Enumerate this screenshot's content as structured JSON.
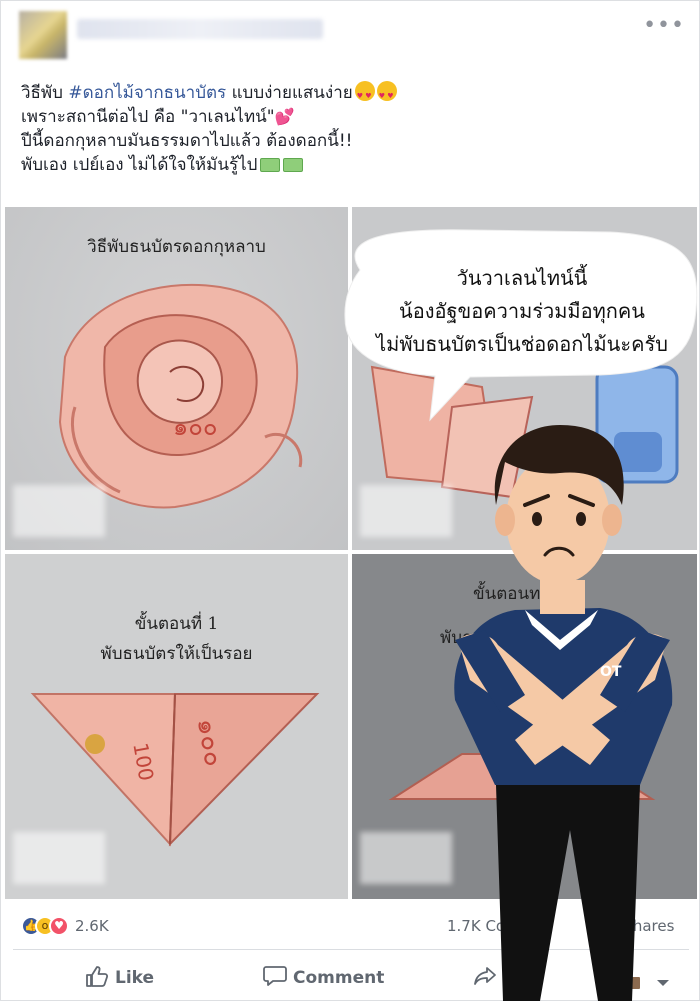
{
  "post": {
    "text_lines": [
      {
        "prefix": "วิธีพับ ",
        "hashtag": "#ดอกไม้จากธนาบัตร",
        "suffix": " แบบง่ายแสนง่าย"
      },
      {
        "text": "เพราะสถานีต่อไป คือ \"วาเลนไทน์\""
      },
      {
        "text": "ปีนี้ดอกกุหลาบมันธรรมดาไปแล้ว ต้องดอกนี้!!"
      },
      {
        "text": "พับเอง เปย์เอง ไม่ได้ใจให้มันรู้ไป"
      }
    ]
  },
  "photos": {
    "tile1_caption": "วิธีพับธนบัตรดอกกุหลาบ",
    "tile3_caption_line1": "ขั้นตอนที่ 1",
    "tile3_caption_line2": "พับธนบัตรให้เป็นรอย",
    "tile4_caption_line1": "ขั้นตอนท",
    "tile4_caption_line2": "พับธ"
  },
  "overlay": {
    "bubble_line1": "วันวาเลนไทน์นี้",
    "bubble_line2": "น้องอัฐขอความร่วมมือทุกคน",
    "bubble_line3": "ไม่พับธนบัตรเป็นช่อดอกไม้นะครับ",
    "shirt_logo": "OT"
  },
  "stats": {
    "reactions_count": "2.6K",
    "comments_count": "1.7K Co",
    "shares_label": "shares"
  },
  "actions": {
    "like_label": "Like",
    "comment_label": "Comment"
  },
  "icons": [
    "more-icon",
    "like-icon",
    "comment-icon",
    "share-icon"
  ],
  "colors": {
    "hashtag": "#365899",
    "like_blue": "#3b5998",
    "love": "#f25268",
    "wow": "#f7c022",
    "shirt": "#1f3a6b"
  }
}
